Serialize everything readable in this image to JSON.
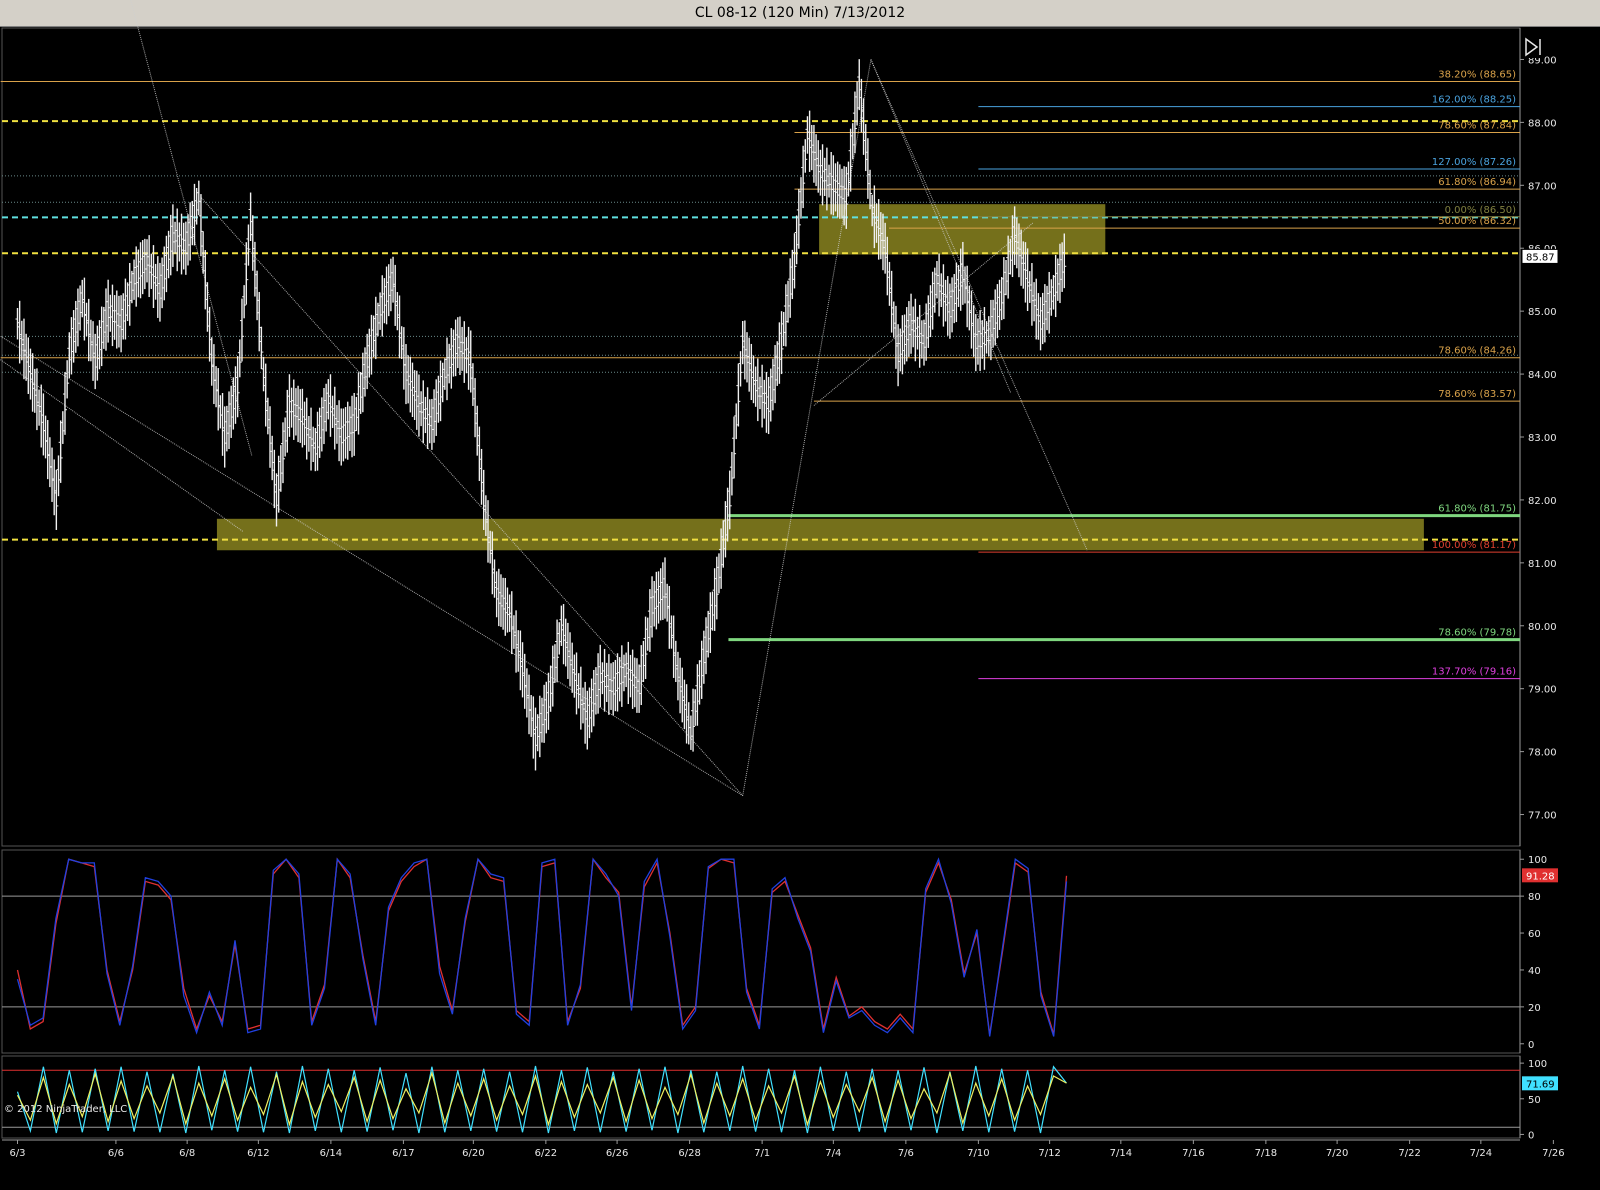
{
  "window": {
    "title": "CL 08-12 (120 Min)  7/13/2012"
  },
  "copyright": "© 2012 NinjaTrader, LLC",
  "colors": {
    "bg": "#000000",
    "grid": "#9a9a9a",
    "text": "#e8e8e8",
    "price_bar": "#f0f0f0",
    "fib_orange": "#d9a24a",
    "fib_blue": "#4aa3df",
    "fib_green": "#7fd77f",
    "fib_red": "#e04030",
    "fib_magenta": "#e040e0",
    "dash_yellow": "#f0e040",
    "dash_cyan": "#60e0e0",
    "zone": "#8a8420",
    "stoch_k": "#e03030",
    "stoch_d": "#2040e0",
    "osc_yellow": "#f0f060",
    "osc_cyan": "#40e0ff",
    "level_red": "#e03030"
  },
  "icons": {
    "nav_end": "skip-to-end-icon"
  },
  "chart_data": [
    {
      "type": "ohlc",
      "name": "CL 08-12 (120 Min)",
      "ylim": [
        76.5,
        89.5
      ],
      "y_ticks": [
        "89.00",
        "88.00",
        "87.00",
        "86.00",
        "85.00",
        "84.00",
        "83.00",
        "82.00",
        "81.00",
        "80.00",
        "79.00",
        "78.00",
        "77.00"
      ],
      "last_price": "85.87",
      "close_path": [
        {
          "x": 0,
          "y": 84.8
        },
        {
          "x": 1,
          "y": 84.0
        },
        {
          "x": 2,
          "y": 83.2
        },
        {
          "x": 3,
          "y": 82.0
        },
        {
          "x": 4,
          "y": 84.3
        },
        {
          "x": 5,
          "y": 85.2
        },
        {
          "x": 6,
          "y": 84.2
        },
        {
          "x": 7,
          "y": 85.0
        },
        {
          "x": 8,
          "y": 84.8
        },
        {
          "x": 9,
          "y": 85.5
        },
        {
          "x": 10,
          "y": 85.8
        },
        {
          "x": 11,
          "y": 85.3
        },
        {
          "x": 12,
          "y": 86.2
        },
        {
          "x": 13,
          "y": 86.0
        },
        {
          "x": 14,
          "y": 86.8
        },
        {
          "x": 15,
          "y": 84.2
        },
        {
          "x": 16,
          "y": 83.0
        },
        {
          "x": 17,
          "y": 83.8
        },
        {
          "x": 18,
          "y": 86.5
        },
        {
          "x": 19,
          "y": 84.0
        },
        {
          "x": 20,
          "y": 82.0
        },
        {
          "x": 21,
          "y": 83.5
        },
        {
          "x": 22,
          "y": 83.3
        },
        {
          "x": 23,
          "y": 82.8
        },
        {
          "x": 24,
          "y": 83.6
        },
        {
          "x": 25,
          "y": 83.0
        },
        {
          "x": 26,
          "y": 83.2
        },
        {
          "x": 27,
          "y": 84.2
        },
        {
          "x": 28,
          "y": 85.0
        },
        {
          "x": 29,
          "y": 85.5
        },
        {
          "x": 30,
          "y": 84.0
        },
        {
          "x": 31,
          "y": 83.5
        },
        {
          "x": 32,
          "y": 83.2
        },
        {
          "x": 33,
          "y": 84.0
        },
        {
          "x": 34,
          "y": 84.5
        },
        {
          "x": 35,
          "y": 84.2
        },
        {
          "x": 36,
          "y": 82.0
        },
        {
          "x": 37,
          "y": 80.5
        },
        {
          "x": 38,
          "y": 80.2
        },
        {
          "x": 39,
          "y": 79.3
        },
        {
          "x": 40,
          "y": 78.2
        },
        {
          "x": 41,
          "y": 78.8
        },
        {
          "x": 42,
          "y": 80.0
        },
        {
          "x": 43,
          "y": 79.2
        },
        {
          "x": 44,
          "y": 78.5
        },
        {
          "x": 45,
          "y": 79.2
        },
        {
          "x": 46,
          "y": 79.0
        },
        {
          "x": 47,
          "y": 79.3
        },
        {
          "x": 48,
          "y": 79.0
        },
        {
          "x": 49,
          "y": 80.3
        },
        {
          "x": 50,
          "y": 80.6
        },
        {
          "x": 51,
          "y": 79.2
        },
        {
          "x": 52,
          "y": 78.3
        },
        {
          "x": 53,
          "y": 79.5
        },
        {
          "x": 54,
          "y": 80.6
        },
        {
          "x": 55,
          "y": 82.0
        },
        {
          "x": 56,
          "y": 84.5
        },
        {
          "x": 57,
          "y": 83.8
        },
        {
          "x": 58,
          "y": 83.5
        },
        {
          "x": 59,
          "y": 84.5
        },
        {
          "x": 60,
          "y": 85.8
        },
        {
          "x": 61,
          "y": 87.8
        },
        {
          "x": 62,
          "y": 87.2
        },
        {
          "x": 63,
          "y": 87.0
        },
        {
          "x": 64,
          "y": 86.8
        },
        {
          "x": 65,
          "y": 88.6
        },
        {
          "x": 66,
          "y": 86.6
        },
        {
          "x": 67,
          "y": 86.0
        },
        {
          "x": 68,
          "y": 84.3
        },
        {
          "x": 69,
          "y": 84.8
        },
        {
          "x": 70,
          "y": 84.5
        },
        {
          "x": 71,
          "y": 85.5
        },
        {
          "x": 72,
          "y": 85.0
        },
        {
          "x": 73,
          "y": 85.6
        },
        {
          "x": 74,
          "y": 84.5
        },
        {
          "x": 75,
          "y": 84.6
        },
        {
          "x": 76,
          "y": 85.2
        },
        {
          "x": 77,
          "y": 86.2
        },
        {
          "x": 78,
          "y": 85.5
        },
        {
          "x": 79,
          "y": 84.8
        },
        {
          "x": 80,
          "y": 85.3
        },
        {
          "x": 81,
          "y": 85.9
        }
      ],
      "swing_lines": [
        {
          "from": {
            "x": -11.4,
            "y": 85.7
          },
          "to": {
            "x": 17.4,
            "y": 81.5
          }
        },
        {
          "from": {
            "x": 6.6,
            "y": 91.6
          },
          "to": {
            "x": 18.1,
            "y": 82.7
          }
        },
        {
          "from": {
            "x": -1.3,
            "y": 84.6
          },
          "to": {
            "x": 56.0,
            "y": 77.3
          }
        },
        {
          "from": {
            "x": 14.2,
            "y": 86.8
          },
          "to": {
            "x": 56.0,
            "y": 77.3
          }
        },
        {
          "from": {
            "x": 56.0,
            "y": 77.3
          },
          "to": {
            "x": 65.9,
            "y": 89.0
          }
        },
        {
          "from": {
            "x": 65.9,
            "y": 89.0
          },
          "to": {
            "x": 76.7,
            "y": 83.7
          }
        },
        {
          "from": {
            "x": 65.9,
            "y": 89.0
          },
          "to": {
            "x": 82.6,
            "y": 81.2
          }
        },
        {
          "from": {
            "x": 61.5,
            "y": 83.5
          },
          "to": {
            "x": 78.4,
            "y": 86.4
          }
        }
      ],
      "zones": [
        {
          "x1": 15.4,
          "x2": 108.6,
          "y1": 81.2,
          "y2": 81.7
        },
        {
          "x1": 61.9,
          "x2": 84.0,
          "y1": 85.9,
          "y2": 86.7
        }
      ],
      "dashed_levels": [
        {
          "y": 88.02,
          "color": "#f0e040"
        },
        {
          "y": 86.49,
          "color": "#60e0e0"
        },
        {
          "y": 85.92,
          "color": "#f0e040"
        },
        {
          "y": 81.37,
          "color": "#f0e040"
        }
      ],
      "thin_levels": [
        87.15,
        86.73,
        84.6,
        84.3,
        84.03
      ],
      "fib_levels": [
        {
          "label": "38.20% (88.65)",
          "y": 88.65,
          "x1": -1.3,
          "color": "#d9a24a"
        },
        {
          "label": "162.00% (88.25)",
          "y": 88.25,
          "x1": 74.2,
          "color": "#4aa3df"
        },
        {
          "label": "78.60% (87.84)",
          "y": 87.84,
          "x1": 60.0,
          "color": "#d9a24a"
        },
        {
          "label": "127.00% (87.26)",
          "y": 87.26,
          "x1": 74.2,
          "color": "#4aa3df"
        },
        {
          "label": "61.80% (86.94)",
          "y": 86.94,
          "x1": 60.0,
          "color": "#d9a24a"
        },
        {
          "label": "0.00% (86.50)",
          "y": 86.5,
          "x1": 74.2,
          "color": "#808040"
        },
        {
          "label": "50.00% (86.32)",
          "y": 86.32,
          "x1": 67.3,
          "color": "#d9a24a"
        },
        {
          "label": "78.60% (84.26)",
          "y": 84.26,
          "x1": -1.3,
          "color": "#d9a24a"
        },
        {
          "label": "78.60% (83.57)",
          "y": 83.57,
          "x1": 61.5,
          "color": "#d9a24a"
        },
        {
          "label": "61.80% (81.75)",
          "y": 81.75,
          "x1": 54.9,
          "color": "#7fd77f",
          "width": 3
        },
        {
          "label": "100.00% (81.17)",
          "y": 81.17,
          "x1": 74.2,
          "color": "#e04030"
        },
        {
          "label": "78.60% (79.78)",
          "y": 79.78,
          "x1": 54.9,
          "color": "#7fd77f",
          "width": 3
        },
        {
          "label": "137.70% (79.16)",
          "y": 79.16,
          "x1": 74.2,
          "color": "#e040e0"
        }
      ],
      "x_dates": [
        {
          "label": "6/3",
          "x": 0
        },
        {
          "label": "6/6",
          "x": 7.6
        },
        {
          "label": "6/8",
          "x": 13.1
        },
        {
          "label": "6/12",
          "x": 18.6
        },
        {
          "label": "6/14",
          "x": 24.2
        },
        {
          "label": "6/17",
          "x": 29.8
        },
        {
          "label": "6/20",
          "x": 35.2
        },
        {
          "label": "6/22",
          "x": 40.8
        },
        {
          "label": "6/26",
          "x": 46.3
        },
        {
          "label": "6/28",
          "x": 51.9
        },
        {
          "label": "7/1",
          "x": 57.5
        },
        {
          "label": "7/4",
          "x": 63.0
        },
        {
          "label": "7/6",
          "x": 68.6
        },
        {
          "label": "7/10",
          "x": 74.2
        },
        {
          "label": "7/12",
          "x": 79.7
        },
        {
          "label": "7/14",
          "x": 85.2
        },
        {
          "label": "7/16",
          "x": 90.8
        },
        {
          "label": "7/18",
          "x": 96.4
        },
        {
          "label": "7/20",
          "x": 101.9
        },
        {
          "label": "7/22",
          "x": 107.5
        },
        {
          "label": "7/24",
          "x": 113.0
        },
        {
          "label": "7/26",
          "x": 118.6
        }
      ]
    },
    {
      "type": "line",
      "name": "Stochastics",
      "ylim": [
        -5,
        105
      ],
      "y_ticks": [
        "100",
        "80",
        "60",
        "40",
        "20",
        "0"
      ],
      "levels": [
        80,
        20
      ],
      "last_value": "91.28",
      "series": [
        {
          "color": "#e03030",
          "values": [
            40,
            8,
            12,
            65,
            100,
            98,
            96,
            40,
            12,
            40,
            88,
            86,
            78,
            30,
            8,
            26,
            12,
            54,
            8,
            10,
            92,
            100,
            90,
            12,
            32,
            100,
            90,
            48,
            12,
            72,
            88,
            96,
            100,
            42,
            18,
            66,
            100,
            90,
            88,
            18,
            12,
            96,
            98,
            12,
            30,
            100,
            90,
            82,
            20,
            85,
            98,
            60,
            10,
            20,
            95,
            100,
            98,
            30,
            10,
            82,
            88,
            70,
            52,
            8,
            36,
            15,
            20,
            12,
            8,
            16,
            8,
            82,
            98,
            78,
            38,
            60,
            5,
            50,
            98,
            93,
            28,
            5,
            91
          ]
        },
        {
          "color": "#2040e0",
          "values": [
            35,
            10,
            14,
            68,
            100,
            98,
            98,
            38,
            10,
            42,
            90,
            88,
            80,
            26,
            6,
            28,
            10,
            56,
            6,
            8,
            94,
            100,
            92,
            10,
            30,
            100,
            92,
            46,
            10,
            74,
            90,
            98,
            100,
            38,
            16,
            68,
            100,
            92,
            90,
            16,
            10,
            98,
            100,
            10,
            32,
            100,
            92,
            80,
            18,
            88,
            100,
            58,
            8,
            18,
            96,
            100,
            100,
            28,
            8,
            84,
            90,
            68,
            50,
            6,
            34,
            14,
            18,
            10,
            6,
            14,
            6,
            84,
            100,
            76,
            36,
            62,
            4,
            52,
            100,
            95,
            26,
            4,
            88
          ]
        }
      ]
    },
    {
      "type": "line",
      "name": "Oscillator",
      "ylim": [
        -5,
        110
      ],
      "y_ticks": [
        "100",
        "50",
        "0"
      ],
      "levels": [
        90,
        10
      ],
      "last_value": "71.69",
      "series": [
        {
          "color": "#40e0ff",
          "values": [
            60,
            5,
            95,
            2,
            90,
            3,
            92,
            5,
            95,
            4,
            88,
            3,
            85,
            2,
            96,
            6,
            90,
            4,
            95,
            3,
            88,
            2,
            96,
            5,
            92,
            3,
            90,
            4,
            94,
            6,
            86,
            2,
            95,
            3,
            90,
            5,
            92,
            4,
            88,
            3,
            96,
            2,
            90,
            5,
            94,
            3,
            88,
            4,
            92,
            6,
            95,
            2,
            90,
            3,
            88,
            5,
            96,
            4,
            92,
            3,
            90,
            2,
            95,
            5,
            88,
            4,
            92,
            3,
            90,
            6,
            94,
            2,
            88,
            5,
            96,
            3,
            92,
            4,
            90,
            2,
            95,
            72
          ]
        },
        {
          "color": "#f0f060",
          "values": [
            55,
            20,
            80,
            15,
            70,
            25,
            85,
            18,
            75,
            22,
            68,
            30,
            82,
            15,
            72,
            26,
            78,
            20,
            66,
            28,
            84,
            14,
            74,
            24,
            70,
            32,
            80,
            18,
            76,
            22,
            64,
            30,
            86,
            16,
            72,
            26,
            78,
            20,
            68,
            28,
            82,
            14,
            74,
            24,
            70,
            30,
            80,
            18,
            76,
            22,
            66,
            28,
            84,
            16,
            72,
            26,
            78,
            20,
            68,
            30,
            82,
            14,
            74,
            24,
            70,
            32,
            80,
            18,
            76,
            22,
            64,
            30,
            86,
            16,
            72,
            26,
            78,
            20,
            68,
            28,
            82,
            72
          ]
        }
      ]
    }
  ]
}
